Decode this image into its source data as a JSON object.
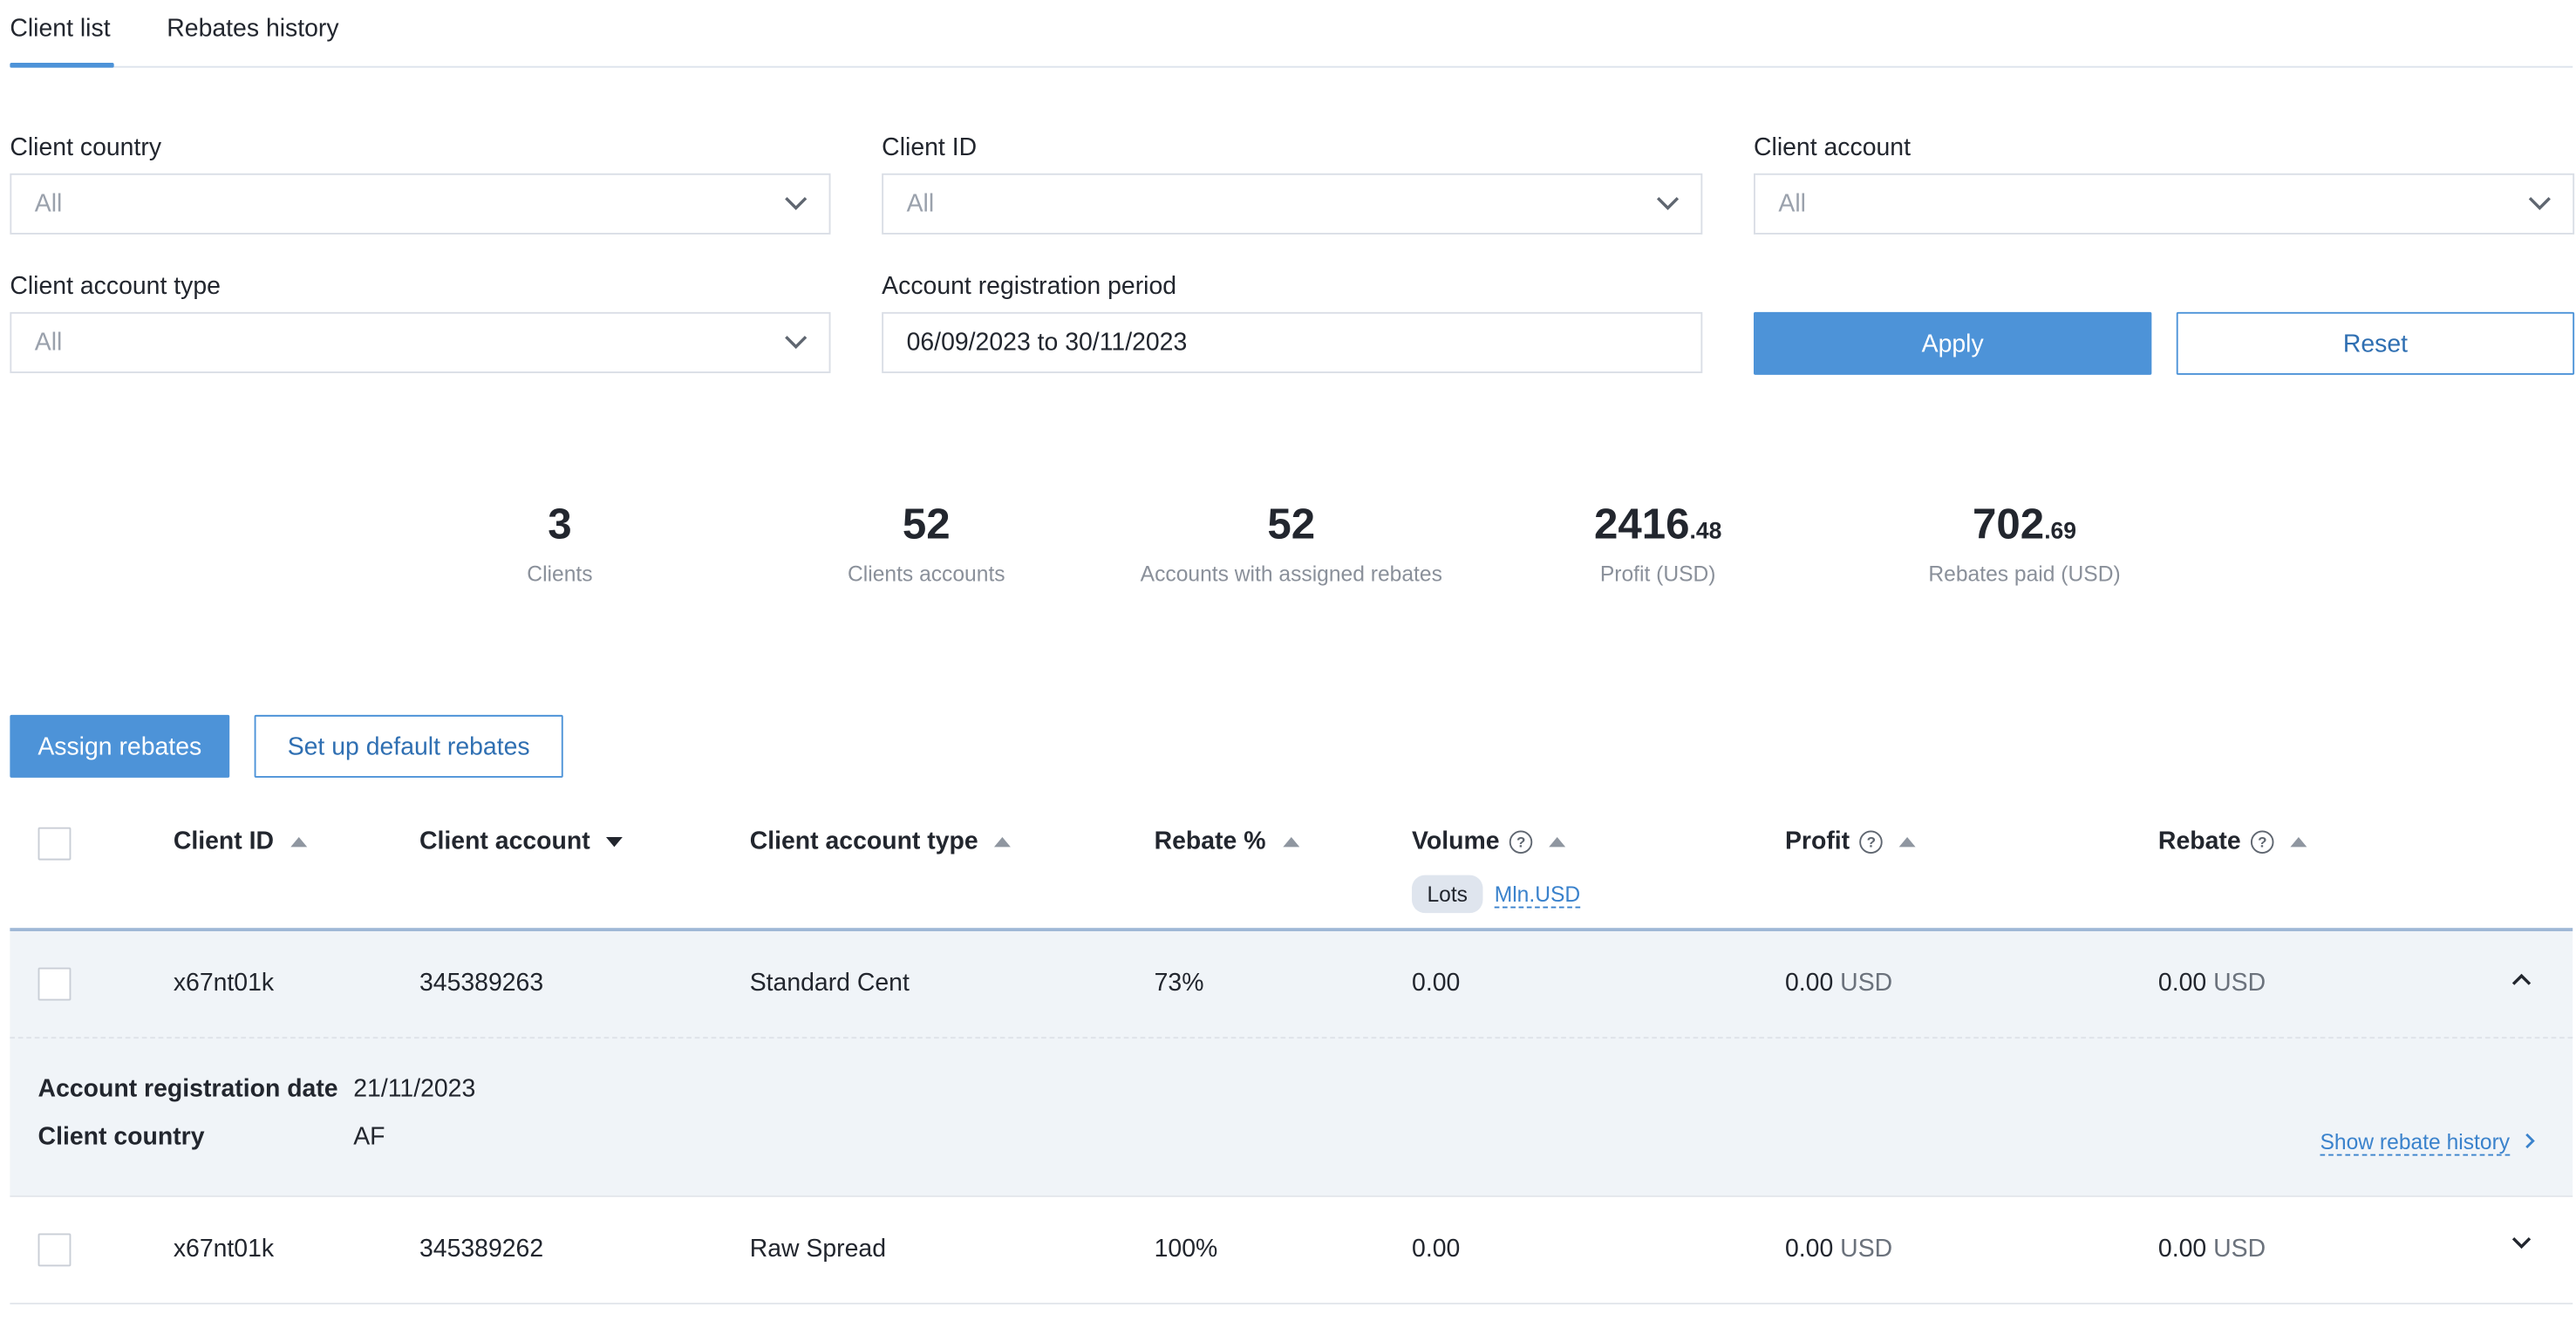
{
  "tabs": [
    {
      "label": "Client list",
      "active": true
    },
    {
      "label": "Rebates history",
      "active": false
    }
  ],
  "filters": {
    "client_country": {
      "label": "Client country",
      "value": "All"
    },
    "client_id": {
      "label": "Client ID",
      "value": "All"
    },
    "client_account": {
      "label": "Client account",
      "value": "All"
    },
    "client_account_type": {
      "label": "Client account type",
      "value": "All"
    },
    "registration_period": {
      "label": "Account registration period",
      "value": "06/09/2023 to 30/11/2023"
    },
    "apply_label": "Apply",
    "reset_label": "Reset"
  },
  "stats": [
    {
      "value": "3",
      "decimal": "",
      "label": "Clients"
    },
    {
      "value": "52",
      "decimal": "",
      "label": "Clients accounts"
    },
    {
      "value": "52",
      "decimal": "",
      "label": "Accounts with assigned rebates"
    },
    {
      "value": "2416",
      "decimal": ".48",
      "label": "Profit (USD)"
    },
    {
      "value": "702",
      "decimal": ".69",
      "label": "Rebates paid (USD)"
    }
  ],
  "actions": {
    "assign_label": "Assign rebates",
    "default_label": "Set up default rebates"
  },
  "table": {
    "columns": {
      "client_id": "Client ID",
      "client_account": "Client account",
      "account_type": "Client account type",
      "rebate_pct": "Rebate %",
      "volume": "Volume",
      "profit": "Profit",
      "rebate": "Rebate"
    },
    "volume_units": {
      "active": "Lots",
      "alt": "Mln.USD"
    },
    "rows": [
      {
        "client_id": "x67nt01k",
        "client_account": "345389263",
        "account_type": "Standard Cent",
        "rebate_pct": "73%",
        "volume": "0.00",
        "profit": "0.00",
        "rebate": "0.00",
        "currency": "USD",
        "expanded": true,
        "details": {
          "reg_date_label": "Account registration date",
          "reg_date": "21/11/2023",
          "country_label": "Client country",
          "country": "AF",
          "history_link": "Show rebate history"
        }
      },
      {
        "client_id": "x67nt01k",
        "client_account": "345389262",
        "account_type": "Raw Spread",
        "rebate_pct": "100%",
        "volume": "0.00",
        "profit": "0.00",
        "rebate": "0.00",
        "currency": "USD",
        "expanded": false
      }
    ]
  },
  "colors": {
    "accent": "#4d93d8",
    "link": "#3a82cc",
    "expanded_row_bg": "#f0f4f8"
  }
}
